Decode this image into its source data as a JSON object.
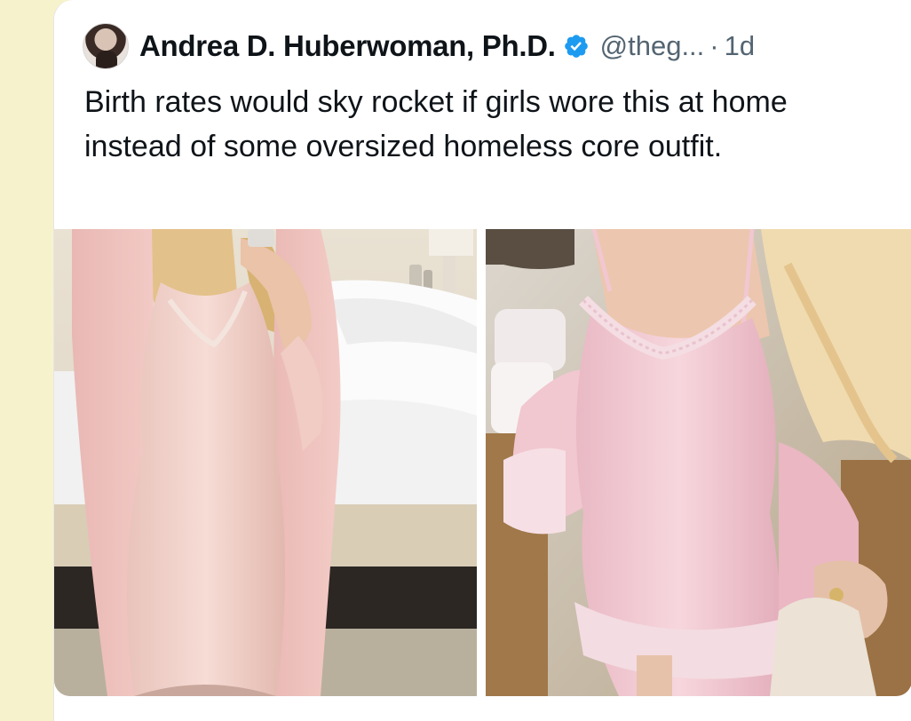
{
  "tweet": {
    "author_name": "Andrea D. Huberwoman, Ph.D.",
    "handle": "@theg...",
    "separator": "·",
    "time": "1d",
    "text": "Birth rates would sky rocket if girls wore this at home instead of some oversized homeless core outfit."
  },
  "icons": {
    "verified": "verified-badge-icon",
    "avatar": "profile-avatar"
  },
  "media": {
    "images": [
      {
        "name": "photo-left",
        "description_label": ""
      },
      {
        "name": "photo-right",
        "description_label": ""
      }
    ]
  },
  "colors": {
    "verified_blue": "#1d9bf0",
    "text_primary": "#0f1419",
    "text_secondary": "#536471",
    "page_background": "#f6f2cc"
  }
}
